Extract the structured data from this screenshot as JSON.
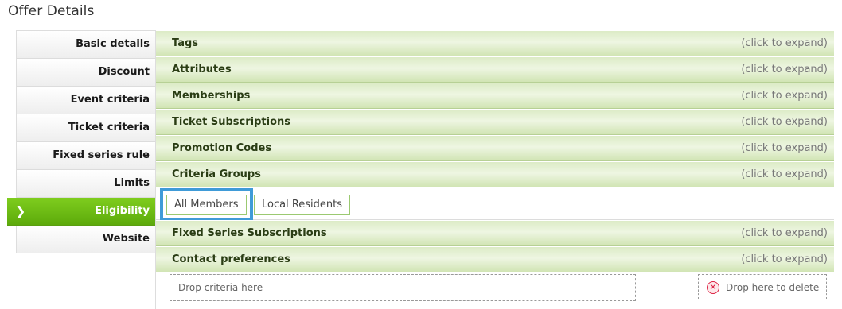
{
  "page": {
    "title": "Offer Details"
  },
  "sidebar": {
    "items": [
      {
        "label": "Basic details"
      },
      {
        "label": "Discount"
      },
      {
        "label": "Event criteria"
      },
      {
        "label": "Ticket criteria"
      },
      {
        "label": "Fixed series rule"
      },
      {
        "label": "Limits"
      },
      {
        "label": "Eligibility",
        "active": true
      },
      {
        "label": "Website"
      }
    ],
    "active_icon": "chevron-right-icon",
    "active_chevron": "❯"
  },
  "accordion": {
    "hint": "(click to expand)",
    "sections": [
      {
        "title": "Tags"
      },
      {
        "title": "Attributes"
      },
      {
        "title": "Memberships"
      },
      {
        "title": "Ticket Subscriptions"
      },
      {
        "title": "Promotion Codes"
      },
      {
        "title": "Criteria Groups"
      },
      {
        "title": "Fixed Series Subscriptions"
      },
      {
        "title": "Contact preferences"
      }
    ]
  },
  "criteria_groups": {
    "chips": [
      {
        "label": "All Members",
        "selected": true
      },
      {
        "label": "Local Residents"
      }
    ]
  },
  "dropzones": {
    "criteria_label": "Drop criteria here",
    "delete_label": "Drop here to delete",
    "delete_icon": "x-circle-icon",
    "delete_glyph": "✕"
  },
  "colors": {
    "accent_green": "#6cbc15",
    "selection_blue": "#3f9bd8",
    "accordion_text": "#2a3d14"
  }
}
